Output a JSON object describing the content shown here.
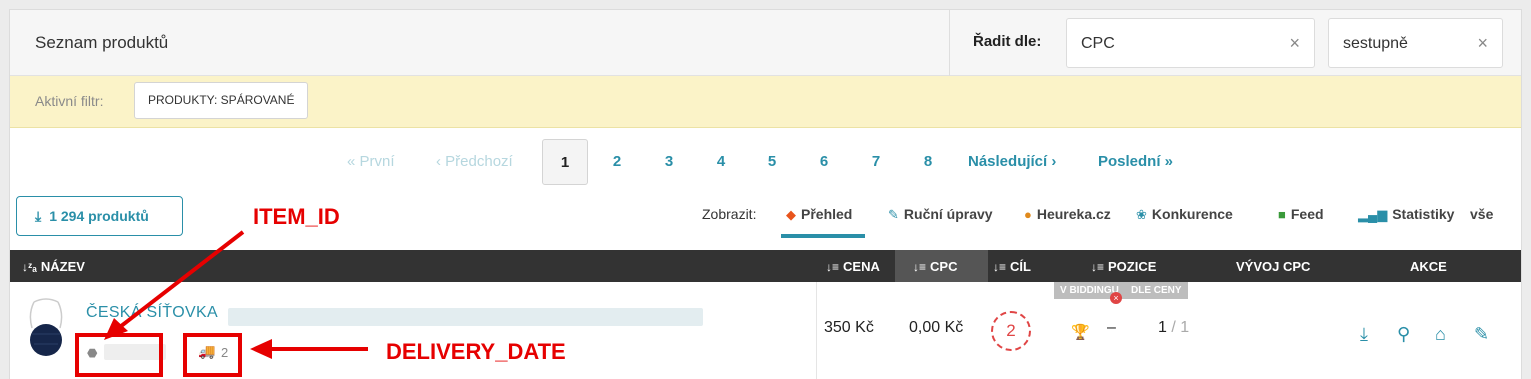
{
  "header": {
    "title": "Seznam produktů",
    "sort_label": "Řadit dle:",
    "sort_field": "CPC",
    "sort_order": "sestupně",
    "clear_glyph": "×"
  },
  "filter": {
    "label": "Aktivní filtr:",
    "chip": "PRODUKTY: SPÁROVANÉ"
  },
  "pagination": {
    "first": "« První",
    "prev": "‹ Předchozí",
    "pages": [
      "1",
      "2",
      "3",
      "4",
      "5",
      "6",
      "7",
      "8"
    ],
    "current": "1",
    "next": "Následující ›",
    "last": "Poslední »"
  },
  "toolbar": {
    "count_button": "1 294 produktů",
    "show_label": "Zobrazit:",
    "tabs": [
      {
        "label": "Přehled",
        "icon": "fox-icon",
        "color": "#e8541c"
      },
      {
        "label": "Ruční úpravy",
        "icon": "edit-icon",
        "color": "#2a8fa8"
      },
      {
        "label": "Heureka.cz",
        "icon": "heureka-search-icon",
        "color": "#e08a1c"
      },
      {
        "label": "Konkurence",
        "icon": "competition-icon",
        "color": "#2a8fa8"
      },
      {
        "label": "Feed",
        "icon": "feed-icon",
        "color": "#3a9a3a"
      },
      {
        "label": "Statistiky",
        "icon": "stats-icon",
        "color": "#2a8fa8"
      },
      {
        "label": "vše",
        "icon": "",
        "color": ""
      }
    ],
    "active_tab": "Přehled"
  },
  "table": {
    "columns": {
      "name": "NÁZEV",
      "price": "CENA",
      "cpc": "CPC",
      "goal": "CÍL",
      "position": "POZICE",
      "cpc_trend": "VÝVOJ CPC",
      "actions": "AKCE"
    },
    "badges": [
      "V BIDDINGU",
      "DLE CENY"
    ],
    "rows": [
      {
        "name": "ČESKÁ SÍŤOVKA",
        "price": "350 Kč",
        "cpc": "0,00 Kč",
        "goal": "2",
        "bidding_value": "–",
        "position": "1",
        "position_total": "/ 1",
        "delivery": "2"
      }
    ]
  },
  "annotations": {
    "item_id": "ITEM_ID",
    "delivery_date": "DELIVERY_DATE",
    "color": "#e60000"
  },
  "colors": {
    "accent": "#2a8fa8",
    "header_dark": "#333333",
    "filter_bg": "#fbf3c8",
    "danger": "#e04545"
  }
}
